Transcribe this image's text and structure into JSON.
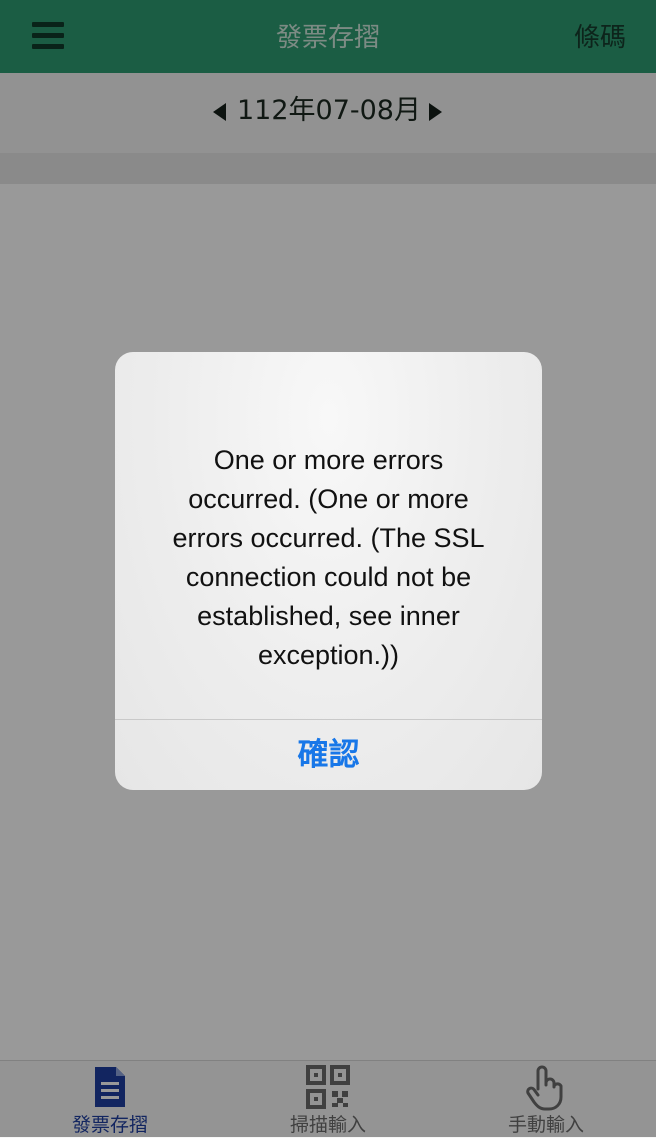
{
  "header": {
    "title": "發票存摺",
    "barcode_label": "條碼",
    "menu_icon": "hamburger-icon"
  },
  "period": {
    "label": "112年07-08月",
    "prev_icon": "triangle-left-icon",
    "next_icon": "triangle-right-icon"
  },
  "tabs": [
    {
      "label": "發票存摺",
      "icon": "document-icon",
      "active": true
    },
    {
      "label": "掃描輸入",
      "icon": "qrcode-icon",
      "active": false
    },
    {
      "label": "手動輸入",
      "icon": "hand-pointer-icon",
      "active": false
    }
  ],
  "alert": {
    "message": "One or more errors\noccurred. (One or more\nerrors occurred. (The SSL\nconnection could not be\nestablished, see inner\nexception.))",
    "confirm_label": "確認"
  },
  "colors": {
    "header_green": "#2e9c72",
    "active_tab": "#1f3fa0",
    "alert_button": "#1877e8",
    "overlay": "rgba(0,0,0,0.40)"
  }
}
